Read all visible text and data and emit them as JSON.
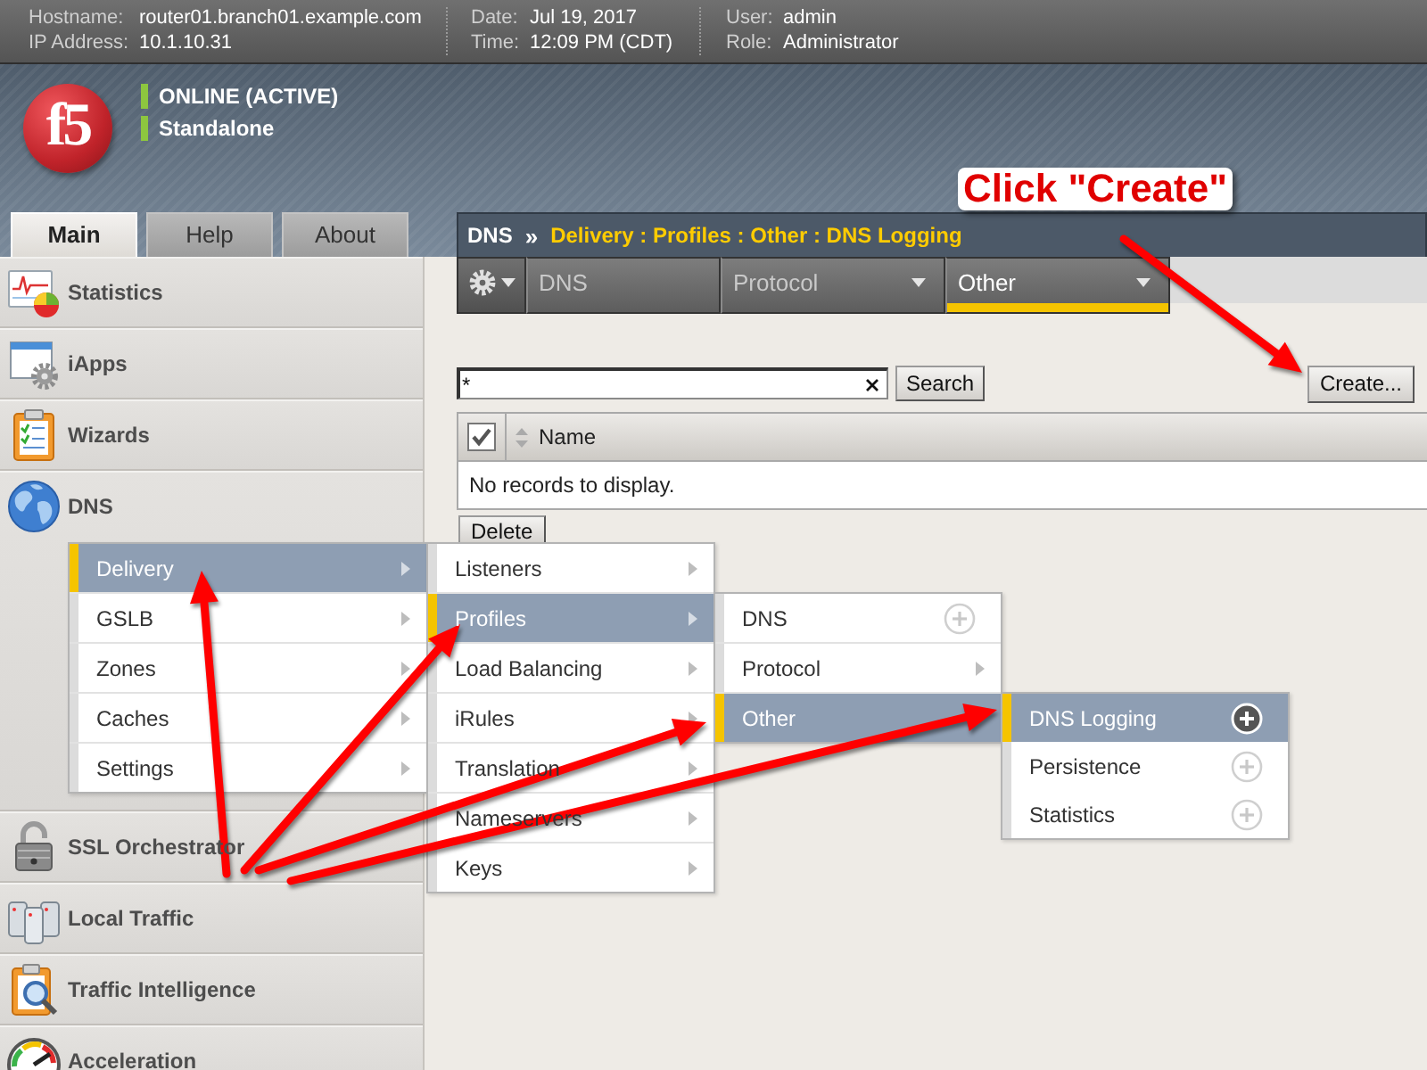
{
  "header": {
    "columns": [
      [
        {
          "label": "Hostname:",
          "value": "router01.branch01.example.com"
        },
        {
          "label": "IP Address:",
          "value": "10.1.10.31"
        }
      ],
      [
        {
          "label": "Date:",
          "value": "Jul 19, 2017"
        },
        {
          "label": "Time:",
          "value": "12:09 PM (CDT)"
        }
      ],
      [
        {
          "label": "User:",
          "value": "admin"
        },
        {
          "label": "Role:",
          "value": "Administrator"
        }
      ]
    ]
  },
  "banner": {
    "logo": "f5",
    "status": [
      "ONLINE (ACTIVE)",
      "Standalone"
    ]
  },
  "nav_tabs": [
    {
      "label": "Main",
      "selected": true
    },
    {
      "label": "Help",
      "selected": false
    },
    {
      "label": "About",
      "selected": false
    }
  ],
  "breadcrumb": {
    "section": "DNS",
    "separator": "»",
    "path": "Delivery : Profiles : Other : DNS Logging"
  },
  "sidebar": {
    "items": [
      {
        "label": "Statistics"
      },
      {
        "label": "iApps"
      },
      {
        "label": "Wizards"
      },
      {
        "label": "DNS",
        "children": [
          {
            "label": "Delivery",
            "kind": "submenu",
            "selected": true,
            "children": [
              {
                "label": "Listeners",
                "kind": "submenu",
                "selected": false
              },
              {
                "label": "Profiles",
                "kind": "submenu",
                "selected": true,
                "children": [
                  {
                    "label": "DNS",
                    "kind": "create",
                    "selected": false
                  },
                  {
                    "label": "Protocol",
                    "kind": "submenu",
                    "selected": false
                  },
                  {
                    "label": "Other",
                    "kind": "submenu",
                    "selected": true,
                    "children": [
                      {
                        "label": "DNS Logging",
                        "kind": "create",
                        "selected": true
                      },
                      {
                        "label": "Persistence",
                        "kind": "create",
                        "selected": false
                      },
                      {
                        "label": "Statistics",
                        "kind": "create",
                        "selected": false
                      }
                    ]
                  }
                ]
              },
              {
                "label": "Load Balancing",
                "kind": "submenu",
                "selected": false
              },
              {
                "label": "iRules",
                "kind": "submenu",
                "selected": false
              },
              {
                "label": "Translation",
                "kind": "submenu",
                "selected": false
              },
              {
                "label": "Nameservers",
                "kind": "submenu",
                "selected": false
              },
              {
                "label": "Keys",
                "kind": "submenu",
                "selected": false
              }
            ]
          },
          {
            "label": "GSLB",
            "kind": "submenu",
            "selected": false
          },
          {
            "label": "Zones",
            "kind": "submenu",
            "selected": false
          },
          {
            "label": "Caches",
            "kind": "submenu",
            "selected": false
          },
          {
            "label": "Settings",
            "kind": "submenu",
            "selected": false
          }
        ]
      },
      {
        "label": "SSL Orchestrator"
      },
      {
        "label": "Local Traffic"
      },
      {
        "label": "Traffic Intelligence"
      },
      {
        "label": "Acceleration"
      }
    ]
  },
  "section_tabs": [
    {
      "label": "DNS",
      "selected": false,
      "dropdown": false
    },
    {
      "label": "Protocol",
      "selected": false,
      "dropdown": true
    },
    {
      "label": "Other",
      "selected": true,
      "dropdown": true
    }
  ],
  "search": {
    "value": "*",
    "button": "Search"
  },
  "create_button": "Create...",
  "table": {
    "select_all_checked": true,
    "columns": [
      "Name"
    ],
    "empty_message": "No records to display."
  },
  "delete_button": "Delete",
  "annotation": {
    "label": "Click \"Create\""
  }
}
